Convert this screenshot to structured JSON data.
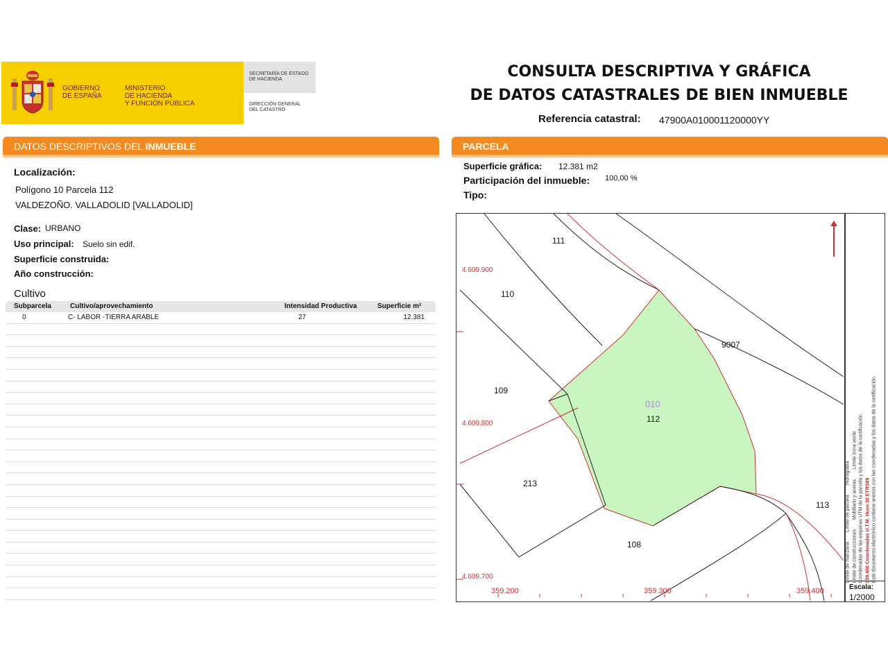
{
  "header": {
    "gobierno": [
      "GOBIERNO",
      "DE ESPAÑA"
    ],
    "ministerio": [
      "MINISTERIO",
      "DE HACIENDA",
      "Y FUNCIÓN PÚBLICA"
    ],
    "secretaria": [
      "SECRETARÍA DE ESTADO",
      "DE HACIENDA"
    ],
    "direccion": [
      "DIRECCIÓN GENERAL",
      "DEL CATASTRO"
    ],
    "title_line1": "CONSULTA DESCRIPTIVA Y GRÁFICA",
    "title_line2": "DE DATOS CATASTRALES DE BIEN INMUEBLE",
    "ref_label": "Referencia catastral:",
    "ref_value": "47900A010001120000YY"
  },
  "descriptivos": {
    "bar_prefix": "DATOS DESCRIPTIVOS DEL ",
    "bar_strong": "INMUEBLE",
    "localizacion_label": "Localización:",
    "localizacion_line1": "Polígono 10 Parcela 112",
    "localizacion_line2": "VALDEZOÑO. VALLADOLID [VALLADOLID]",
    "clase_label": "Clase:",
    "clase_value": "URBANO",
    "uso_label": "Uso principal:",
    "uso_value": "Suelo sin edif.",
    "superficie_construida_label": "Superficie construida:",
    "anio_label": "Año construcción:"
  },
  "cultivo": {
    "title": "Cultivo",
    "columns": [
      "Subparcela",
      "Cultivo/aprovechamiento",
      "Intensidad Productiva",
      "Superficie m²"
    ],
    "rows": [
      {
        "subparcela": "0",
        "cultivo": "C- LABOR -TIERRA ARABLE",
        "intensidad": "27",
        "superficie": "12.381"
      }
    ]
  },
  "parcela": {
    "bar_label": "PARCELA",
    "superficie_label": "Superficie gráfica:",
    "superficie_value": "12.381 m2",
    "participacion_label": "Participación del inmueble:",
    "participacion_value": "100,00 %",
    "tipo_label": "Tipo:"
  },
  "map": {
    "colors": {
      "parcel_fill": "#c8f5c0",
      "red_line": "#d03030",
      "black_line": "#222222",
      "label_violet": "#b08ad8"
    },
    "parcel_labels": {
      "p111": "111",
      "p110": "110",
      "p9007": "9007",
      "p109": "109",
      "p010": "010",
      "p112": "112",
      "p213": "213",
      "p113": "113",
      "p108": "108"
    },
    "y_ticks": [
      "4.609.900",
      "4.609.800",
      "4.609.700"
    ],
    "x_ticks": [
      "359.200",
      "359.300",
      "359.400"
    ],
    "legend": {
      "col1": [
        "Límite de manzana",
        "Límite de parcela",
        "Hidrografía"
      ],
      "col2": [
        "Límite de construcciones",
        "Mobiliario y aceras",
        "Límite zona verde"
      ],
      "note1": "Coordenadas de las esquinas UTM de la parcela y los datos de la certificación.",
      "note2": "359.400 Coordenadas U.T.M. Huso 30 ETRS89",
      "note3": "Este documento electrónico contiene anexos con las coordenadas y los datos de la certificación."
    },
    "escala_label": "Escala:",
    "escala_value": "1/2000"
  }
}
